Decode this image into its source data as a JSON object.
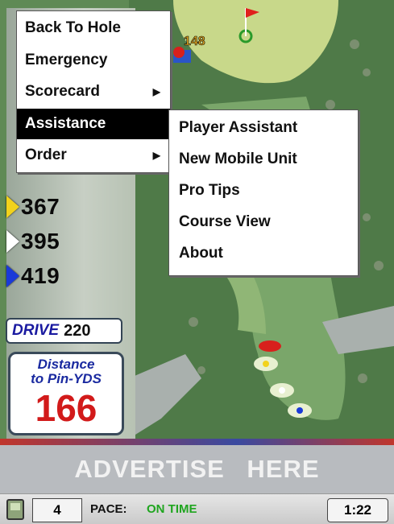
{
  "menu": {
    "items": [
      {
        "label": "Back To Hole",
        "has_submenu": false
      },
      {
        "label": "Emergency",
        "has_submenu": false
      },
      {
        "label": "Scorecard",
        "has_submenu": true
      },
      {
        "label": "Assistance",
        "has_submenu": true,
        "selected": true
      },
      {
        "label": "Order",
        "has_submenu": true
      }
    ],
    "arrow_glyph": "▶"
  },
  "submenu": {
    "items": [
      "Player Assistant",
      "New Mobile Unit",
      "Pro Tips",
      "Course View",
      "About"
    ]
  },
  "map": {
    "flag_yardage": "148"
  },
  "yardages": [
    {
      "value": "367",
      "tee_color": "#f2d21c"
    },
    {
      "value": "395",
      "tee_color": "#ffffff"
    },
    {
      "value": "419",
      "tee_color": "#1a3ad8"
    }
  ],
  "drive": {
    "label": "DRIVE",
    "value": "220"
  },
  "distance": {
    "line1": "Distance",
    "line2": "to Pin-YDS",
    "value": "166"
  },
  "ad": {
    "text": "ADVERTISE HERE"
  },
  "status": {
    "hole": "4",
    "pace_label": "PACE:",
    "pace_value": "ON TIME",
    "time": "1:22"
  },
  "colors": {
    "menu_selected_bg": "#000000",
    "distance_value": "#d21a1a",
    "pace_ok": "#1fa51f"
  }
}
